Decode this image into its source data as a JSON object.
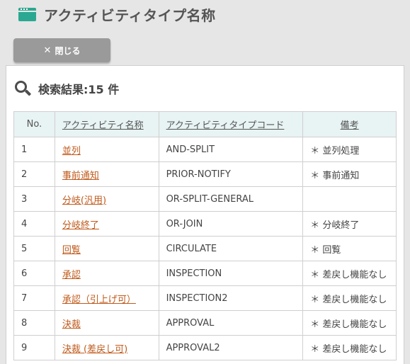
{
  "header": {
    "title": "アクティビティタイプ名称"
  },
  "toolbar": {
    "close_label": "閉じる"
  },
  "results": {
    "label": "検索結果:15 件"
  },
  "table": {
    "columns": [
      "No.",
      "アクティビティ名称",
      "アクティビティタイプコード",
      "備考"
    ],
    "rows": [
      {
        "no": "1",
        "name": "並列",
        "code": "AND-SPLIT",
        "note": "＊ 並列処理"
      },
      {
        "no": "2",
        "name": "事前通知",
        "code": "PRIOR-NOTIFY",
        "note": "＊ 事前通知"
      },
      {
        "no": "3",
        "name": "分岐(汎用)",
        "code": "OR-SPLIT-GENERAL",
        "note": ""
      },
      {
        "no": "4",
        "name": "分岐終了",
        "code": "OR-JOIN",
        "note": "＊ 分岐終了"
      },
      {
        "no": "5",
        "name": "回覧",
        "code": "CIRCULATE",
        "note": "＊ 回覧"
      },
      {
        "no": "6",
        "name": "承認",
        "code": "INSPECTION",
        "note": "＊ 差戻し機能なし"
      },
      {
        "no": "7",
        "name": "承認（引上げ可）",
        "code": "INSPECTION2",
        "note": "＊ 差戻し機能なし"
      },
      {
        "no": "8",
        "name": "決裁",
        "code": "APPROVAL",
        "note": "＊ 差戻し機能なし"
      },
      {
        "no": "9",
        "name": "決裁 (差戻し可)",
        "code": "APPROVAL2",
        "note": "＊ 差戻し機能なし"
      }
    ]
  },
  "colors": {
    "accent": "#2ba891",
    "link": "#c05a1c",
    "header_bg": "#e8f3f3",
    "button_bg": "#9a9a9a"
  }
}
